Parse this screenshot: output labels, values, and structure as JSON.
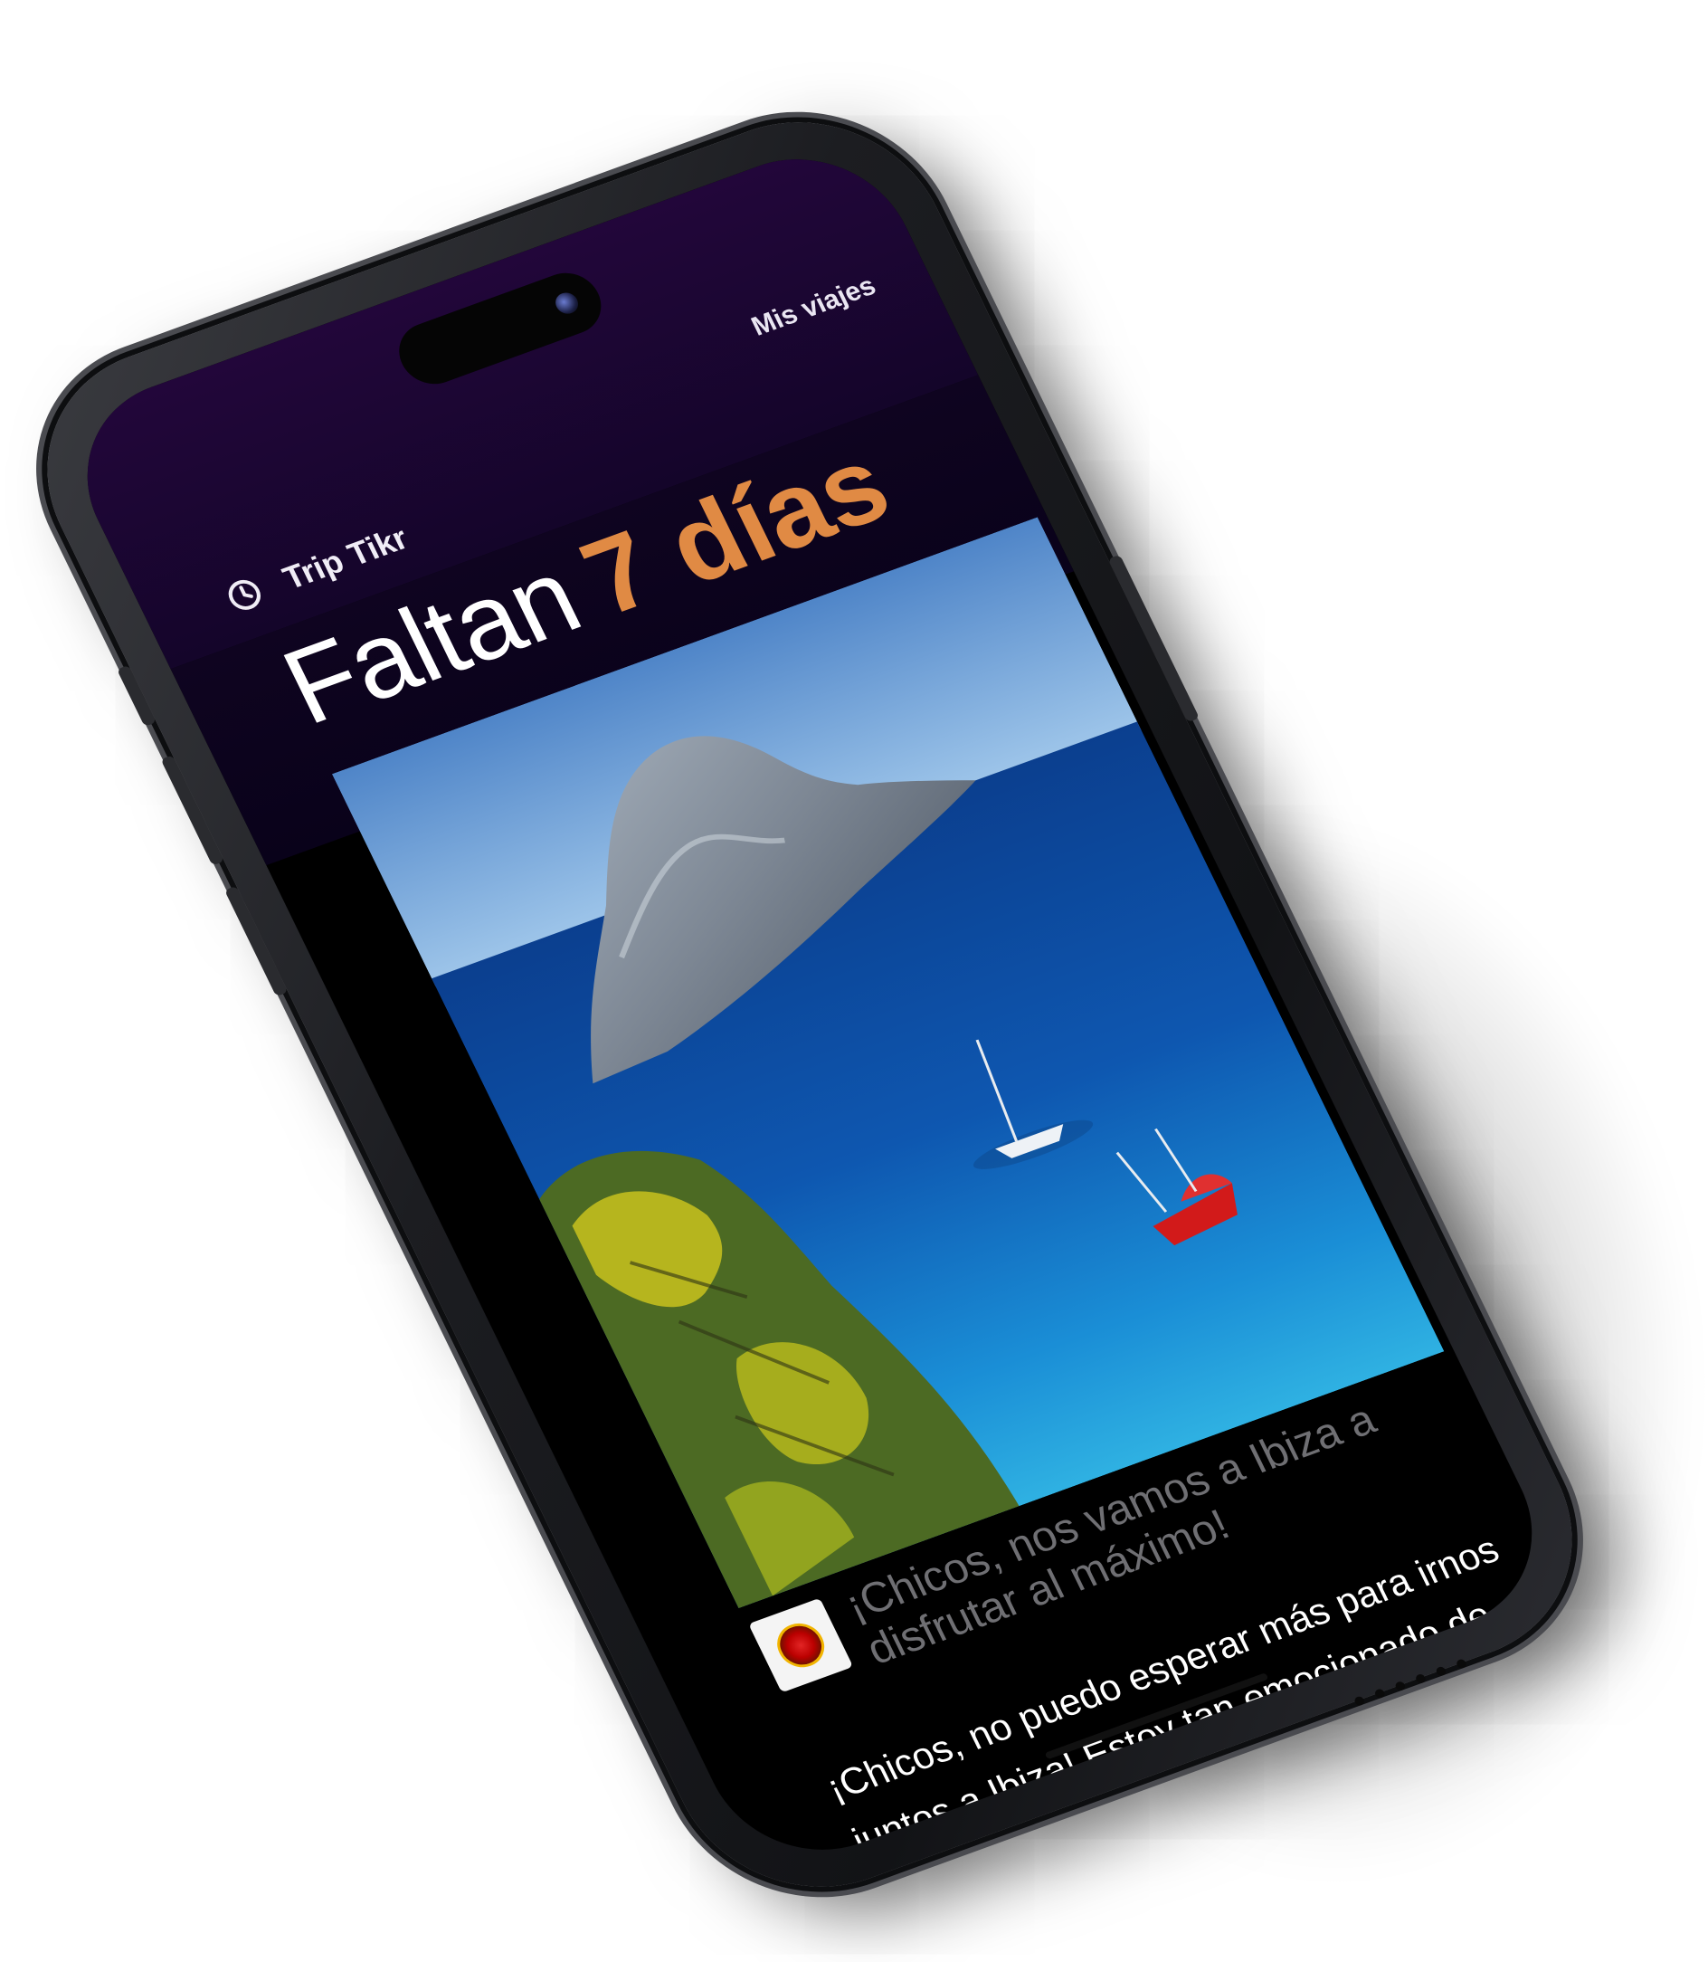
{
  "app": {
    "brand_name": "Trip Tikr",
    "nav_my_trips": "Mis viajes"
  },
  "hero": {
    "prefix": "Faltan",
    "highlight": "7 días"
  },
  "post": {
    "title": "¡Chicos, nos vamos a Ibiza a disfrutar al máximo!",
    "body": "¡Chicos, no puedo esperar más para irnos juntos a Ibiza! Estoy tan emocionado de estar en la playa, bailando y pasándola"
  },
  "colors": {
    "accent": "#e08a44",
    "header_bg": "#22063a",
    "screen_bg": "#000000",
    "title_muted": "#6f6f73"
  },
  "icons": {
    "brand_icon": "clock-icon",
    "avatar_icon": "avatar"
  }
}
